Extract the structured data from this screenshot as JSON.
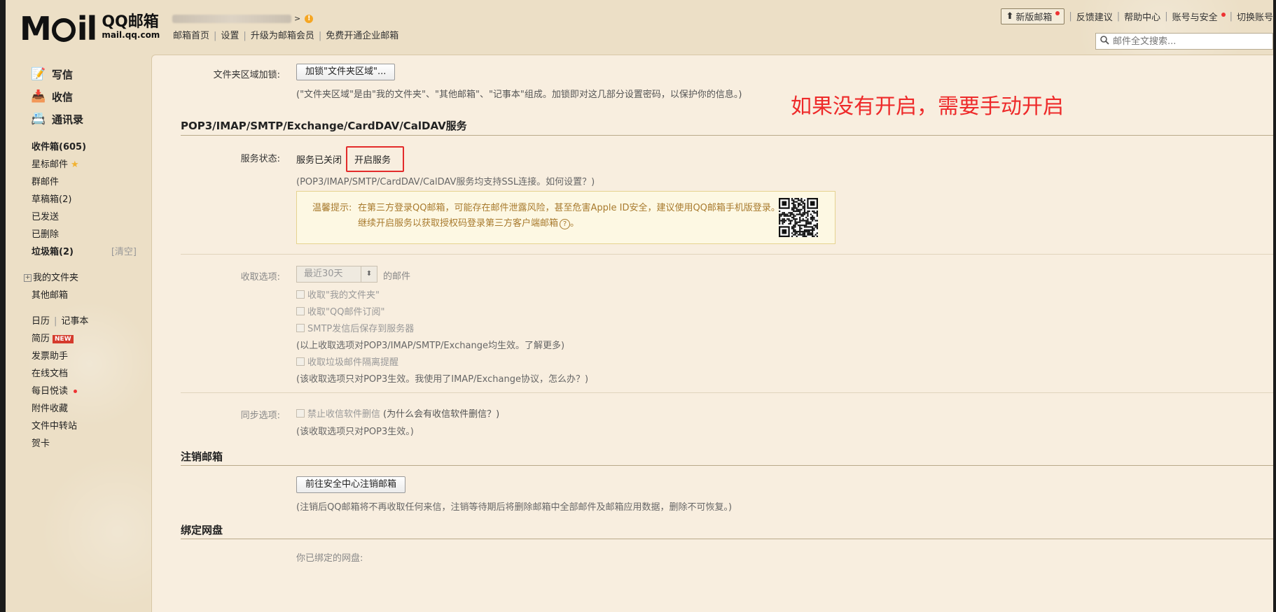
{
  "header": {
    "logo_cn": "QQ邮箱",
    "logo_en": "mail.qq.com",
    "account_arrow": ">",
    "warning_mark": "!",
    "nav": [
      "邮箱首页",
      "设置",
      "升级为邮箱会员",
      "免费开通企业邮箱"
    ],
    "new_version": "新版邮箱",
    "links": [
      "反馈建议",
      "帮助中心",
      "账号与安全",
      "切换账号"
    ],
    "search_placeholder": "邮件全文搜索..."
  },
  "sidebar": {
    "compose": "写信",
    "receive": "收信",
    "contacts": "通讯录",
    "inbox": "收件箱(605)",
    "starred": "星标邮件",
    "group": "群邮件",
    "drafts": "草稿箱(2)",
    "sent": "已发送",
    "deleted": "已删除",
    "trash": "垃圾箱(2)",
    "trash_clear": "[清空]",
    "my_folders": "我的文件夹",
    "other_mailboxes": "其他邮箱",
    "calendar": "日历",
    "notes": "记事本",
    "resume": "简历",
    "new_badge": "NEW",
    "invoice": "发票助手",
    "online_docs": "在线文档",
    "daily_reading": "每日悦读",
    "attachments": "附件收藏",
    "file_transfer": "文件中转站",
    "cards": "贺卡"
  },
  "main": {
    "folder_lock_label": "文件夹区域加锁:",
    "folder_lock_button": "加锁\"文件夹区域\"...",
    "folder_lock_hint": "(\"文件夹区域\"是由\"我的文件夹\"、\"其他邮箱\"、\"记事本\"组成。加锁即对这几部分设置密码，以保护你的信息。)",
    "annotation": "如果没有开启，需要手动开启",
    "pop_section_title": "POP3/IMAP/SMTP/Exchange/CardDAV/CalDAV服务",
    "service_status_label": "服务状态:",
    "service_status_value": "服务已关闭",
    "enable_service": "开启服务",
    "ssl_hint": "(POP3/IMAP/SMTP/CardDAV/CalDAV服务均支持SSL连接。如何设置？)",
    "tip_title": "温馨提示:",
    "tip_line1": "在第三方登录QQ邮箱，可能存在邮件泄露风险，甚至危害Apple ID安全，建议使用QQ邮箱手机版登录。",
    "tip_line2": "继续开启服务以获取授权码登录第三方客户端邮箱",
    "tip_help": "?",
    "receive_options_label": "收取选项:",
    "receive_range": "最近30天",
    "receive_range_suffix": "的邮件",
    "opt_my_folders": "收取\"我的文件夹\"",
    "opt_qq_subscription": "收取\"QQ邮件订阅\"",
    "opt_smtp_save": "SMTP发信后保存到服务器",
    "opt_hint1": "(以上收取选项对POP3/IMAP/SMTP/Exchange均生效。了解更多)",
    "opt_spam": "收取垃圾邮件隔离提醒",
    "opt_hint2": "(该收取选项只对POP3生效。我使用了IMAP/Exchange协议，怎么办？)",
    "sync_label": "同步选项:",
    "sync_opt": "禁止收信软件删信",
    "sync_opt_why": "(为什么会有收信软件删信？)",
    "sync_hint": "(该收取选项只对POP3生效。)",
    "cancel_section_title": "注销邮箱",
    "cancel_button": "前往安全中心注销邮箱",
    "cancel_hint": "(注销后QQ邮箱将不再收取任何来信，注销等待期后将删除邮箱中全部邮件及邮箱应用数据，删除不可恢复。)",
    "netdisk_section_title": "绑定网盘",
    "netdisk_hint": "你已绑定的网盘:"
  },
  "colors": {
    "annotation": "#ee2a2a",
    "highlight_box": "#e32b2b",
    "tip_text": "#a87a2d",
    "tip_bg": "#fdf8e3"
  }
}
